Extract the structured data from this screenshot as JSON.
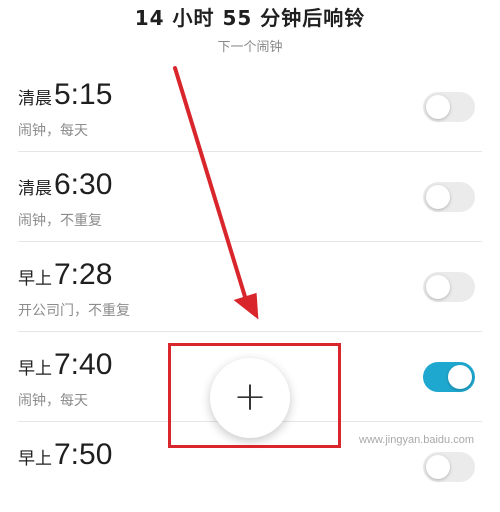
{
  "header": {
    "countdown": "14 小时 55 分钟后响铃",
    "subtitle": "下一个闹钟"
  },
  "alarms": [
    {
      "period": "清晨",
      "time": "5:15",
      "label": "闹钟，每天",
      "enabled": false
    },
    {
      "period": "清晨",
      "time": "6:30",
      "label": "闹钟，不重复",
      "enabled": false
    },
    {
      "period": "早上",
      "time": "7:28",
      "label": "开公司门，不重复",
      "enabled": false
    },
    {
      "period": "早上",
      "time": "7:40",
      "label": "闹钟，每天",
      "enabled": true
    },
    {
      "period": "早上",
      "time": "7:50",
      "label": "",
      "enabled": false
    }
  ],
  "fab": {
    "symbol": "+",
    "icon": "plus-icon"
  },
  "annotation": {
    "color": "#d9262c"
  },
  "colors": {
    "toggle_on": "#1fa8cf",
    "toggle_off": "#ebebeb"
  },
  "watermark": "www.jingyan.baidu.com"
}
